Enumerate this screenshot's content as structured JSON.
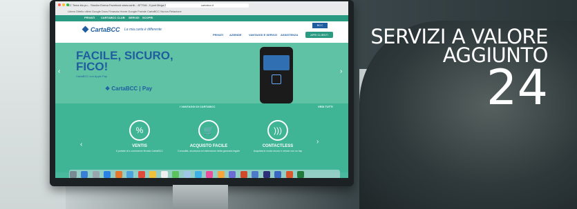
{
  "browser": {
    "tabs": "CC  Tema blu pu...  Stockio Emma  Facebook  www.cartb...  ATTIVA - Il part  Mega Stoccolm  Verona ETRE - Home",
    "url": "cartabcc.it",
    "bookmarks": "Libero Ditello ultimi  Google Docs  Finanzia  Home  Google  Portale CartaBCC  Nuova Relazione"
  },
  "site": {
    "promo_items": [
      "PRIVATI",
      "CARTABCC CLUB",
      "SERVIZI",
      "SCOPRI"
    ],
    "logo": "CartaBCC",
    "tagline": "La mia carta è differente",
    "nav": [
      "PRIVATI",
      "AZIENDE",
      "VANTAGGI E SERVIZI",
      "ASSISTENZA"
    ],
    "cta": "APRI CLIENTI",
    "bank_logo": "BCC",
    "hero_title_line1": "FACILE, SICURO,",
    "hero_title_line2": "FICO!",
    "hero_sub": "CartaBCC con Apple Pay",
    "hero_logos": "❖ CartaBCC  |  Pay",
    "vantaggi_title": "I VANTAGGI DI CARTABCC",
    "vedi_tutti": "VEDI TUTTI",
    "features": [
      {
        "name": "VENTIS",
        "desc": "Il portale di e-commerce firmato CartaBCC",
        "icon": "%"
      },
      {
        "name": "ACQUISTO FACILE",
        "desc": "Comodità, sicurezza ed estensione della garanzia legale",
        "icon": "🛒"
      },
      {
        "name": "CONTACTLESS",
        "desc": "Acquista in modo sicuro e veloce con un tap",
        "icon": ")))"
      }
    ]
  },
  "overlay": {
    "line1": "SERVIZI A VALORE",
    "line2": "AGGIUNTO",
    "number": "24"
  },
  "colors": {
    "accent": "#49b89c",
    "brand": "#1f5d9f"
  }
}
